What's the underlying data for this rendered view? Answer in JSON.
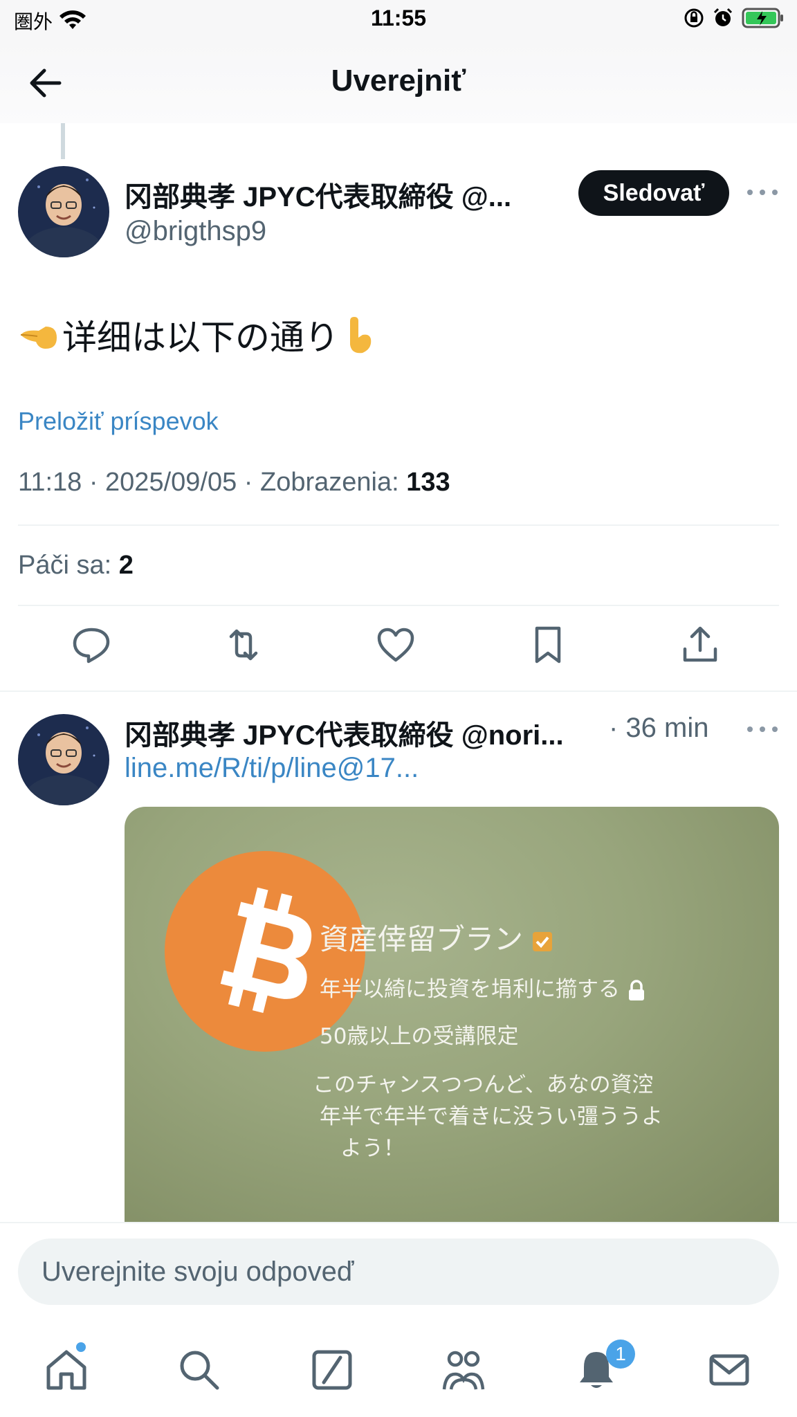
{
  "status_bar": {
    "carrier": "圏外",
    "time": "11:55"
  },
  "header": {
    "title": "Uverejniť"
  },
  "post": {
    "author_name": "冈部典孝 JPYC代表取締役 @...",
    "author_handle": "@brigthsp9",
    "follow_label": "Sledovať",
    "text": "详细は以下の通り",
    "translate_label": "Preložiť príspevok",
    "timestamp": "11:18 · 2025/09/05 · Zobrazenia:",
    "views": "133",
    "likes_label": "Páči sa:",
    "likes_count": "2"
  },
  "reply": {
    "author_name": "冈部典孝 JPYC代表取締役 @nori...",
    "time": "· 36 min",
    "link": "line.me/R/ti/p/line@17...",
    "media_lines": [
      "資産倖留ブラン",
      "年半以綺に投資を埍利に擶する",
      "50歳以上の受講限定",
      "このチャンスつつんど、あなの資涳",
      "年半で年半で着きに没うい彊ううよ",
      "よう！"
    ]
  },
  "composer": {
    "placeholder": "Uverejnite svoju odpoveď"
  },
  "nav": {
    "notification_count": "1"
  },
  "colors": {
    "accent_link": "#3a86c4",
    "bitcoin_orange": "#ec8a3c",
    "badge_blue": "#4aa3e8"
  }
}
